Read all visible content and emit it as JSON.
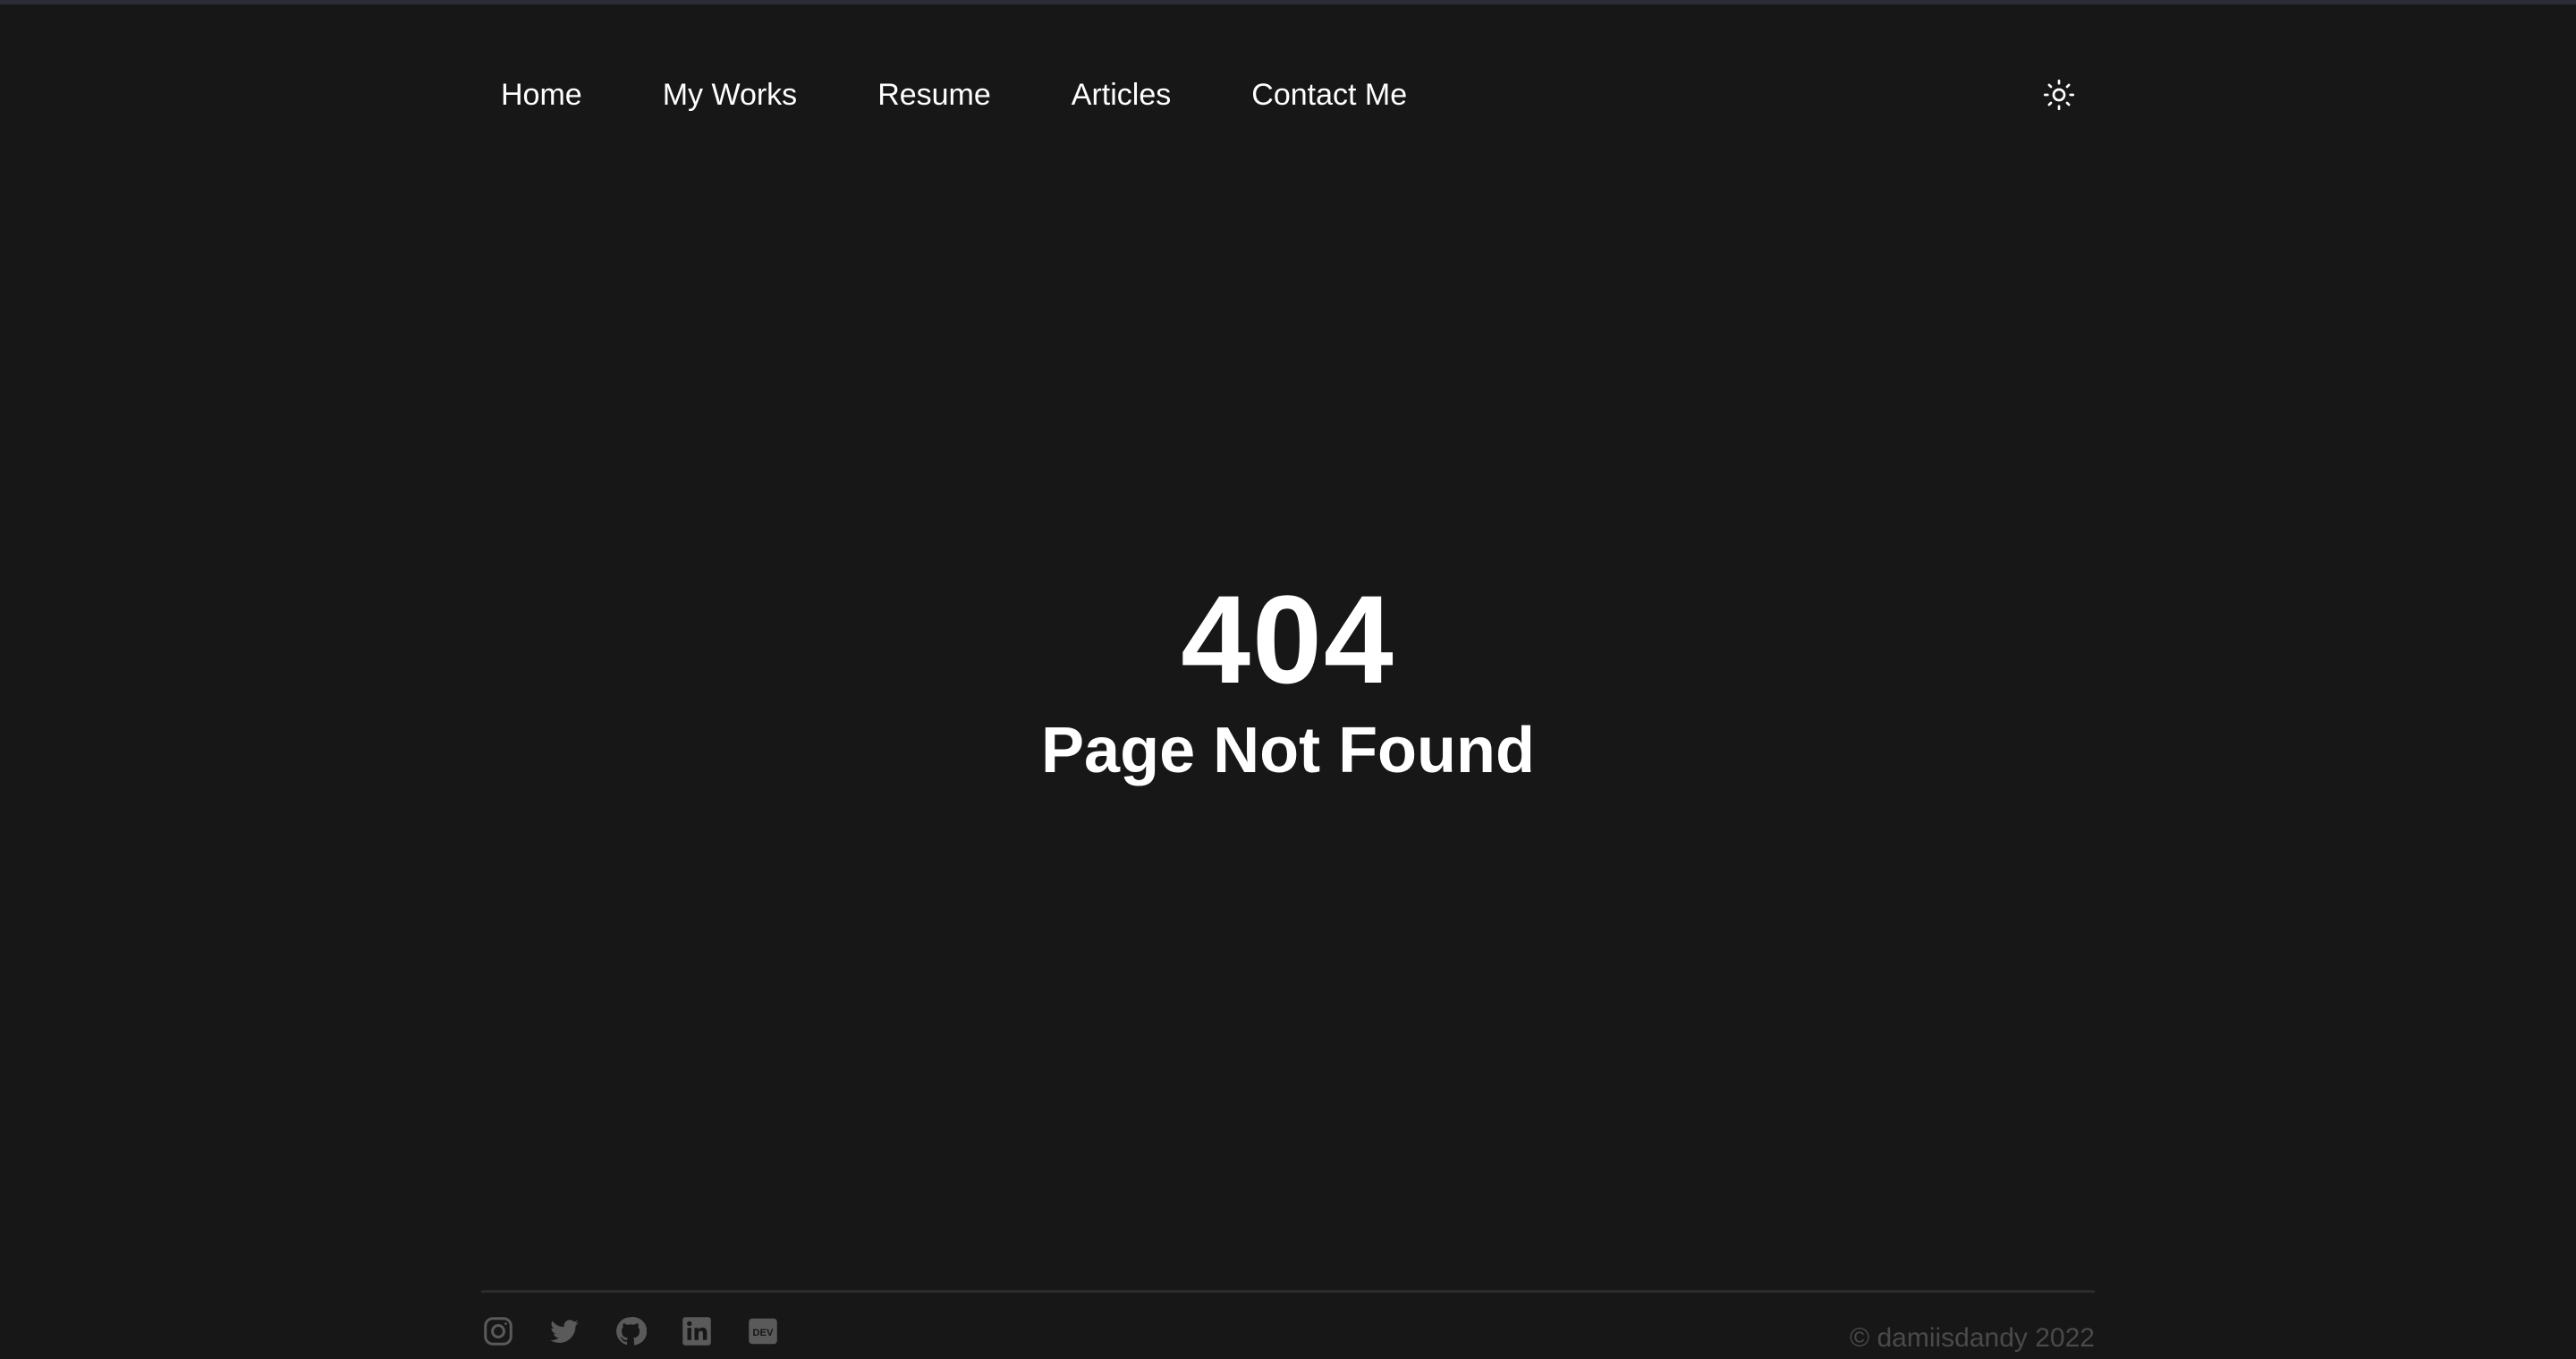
{
  "nav": {
    "links": [
      "Home",
      "My Works",
      "Resume",
      "Articles",
      "Contact Me"
    ],
    "theme_toggle_icon": "sun-icon"
  },
  "hero": {
    "code": "404",
    "message": "Page Not Found"
  },
  "footer": {
    "social_icons": [
      "instagram-icon",
      "twitter-icon",
      "github-icon",
      "linkedin-icon",
      "dev-icon"
    ],
    "dev_icon_text": "DEV",
    "copyright": "© damiisdandy 2022"
  },
  "colors": {
    "background": "#171717",
    "text": "#ffffff",
    "muted": "#4a4a4a",
    "divider": "#2a2a2a"
  }
}
